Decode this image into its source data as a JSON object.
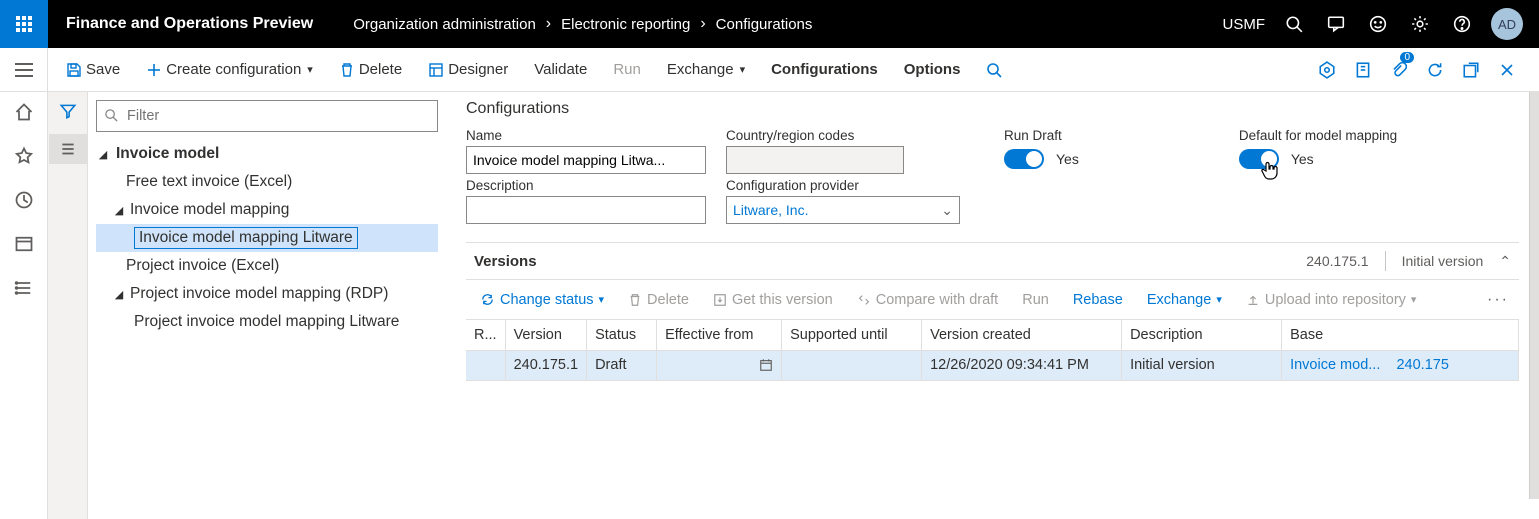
{
  "topbar": {
    "app_title": "Finance and Operations Preview",
    "breadcrumb": [
      "Organization administration",
      "Electronic reporting",
      "Configurations"
    ],
    "company": "USMF",
    "avatar": "AD"
  },
  "cmdbar": {
    "save": "Save",
    "create": "Create configuration",
    "delete": "Delete",
    "designer": "Designer",
    "validate": "Validate",
    "run": "Run",
    "exchange": "Exchange",
    "configurations": "Configurations",
    "options": "Options"
  },
  "filter": {
    "placeholder": "Filter"
  },
  "tree": {
    "n0": "Invoice model",
    "n1": "Free text invoice (Excel)",
    "n2": "Invoice model mapping",
    "n3": "Invoice model mapping Litware",
    "n4": "Project invoice (Excel)",
    "n5": "Project invoice model mapping (RDP)",
    "n6": "Project invoice model mapping Litware"
  },
  "details": {
    "section": "Configurations",
    "name_label": "Name",
    "name_value": "Invoice model mapping Litwa...",
    "desc_label": "Description",
    "desc_value": "",
    "country_label": "Country/region codes",
    "provider_label": "Configuration provider",
    "provider_value": "Litware, Inc.",
    "rundraft_label": "Run Draft",
    "rundraft_value": "Yes",
    "default_label": "Default for model mapping",
    "default_value": "Yes"
  },
  "versions": {
    "title": "Versions",
    "summary_version": "240.175.1",
    "summary_desc": "Initial version",
    "cmds": {
      "change_status": "Change status",
      "delete": "Delete",
      "get": "Get this version",
      "compare": "Compare with draft",
      "run": "Run",
      "rebase": "Rebase",
      "exchange": "Exchange",
      "upload": "Upload into repository"
    },
    "columns": {
      "r": "R...",
      "version": "Version",
      "status": "Status",
      "eff": "Effective from",
      "sup": "Supported until",
      "created": "Version created",
      "desc": "Description",
      "base": "Base"
    },
    "row": {
      "version": "240.175.1",
      "status": "Draft",
      "eff": "",
      "sup": "",
      "created": "12/26/2020 09:34:41 PM",
      "desc": "Initial version",
      "base_name": "Invoice mod...",
      "base_ver": "240.175"
    }
  }
}
